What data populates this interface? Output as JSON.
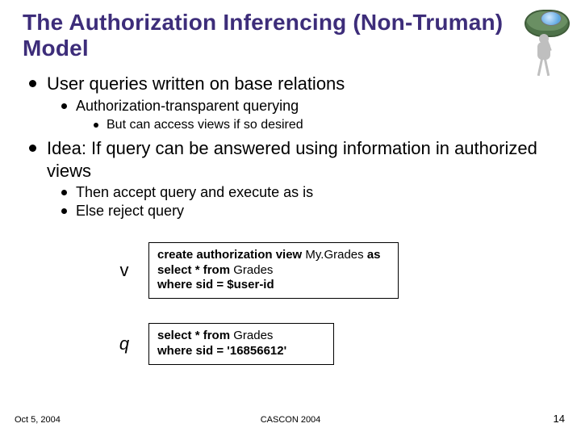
{
  "title": "The Authorization Inferencing (Non-Truman) Model",
  "bullets": {
    "b1": "User queries written on base relations",
    "b1_1": "Authorization-transparent querying",
    "b1_1_1": "But can access views if so desired",
    "b2": "Idea: If query can be answered using information in authorized views",
    "b2_1": "Then accept query and execute as is",
    "b2_2": "Else reject query"
  },
  "code": {
    "v_label": "v",
    "v": {
      "kw_create": "create authorization view",
      "viewname": "My.Grades",
      "kw_as": "as",
      "kw_select": "select * from",
      "relation": "Grades",
      "where": "where sid = $user-id"
    },
    "q_label": "q",
    "q": {
      "kw_select": "select * from",
      "relation": "Grades",
      "where": "where sid = '16856612'"
    }
  },
  "footer": {
    "left": "Oct 5, 2004",
    "center": "CASCON 2004",
    "right": "14"
  }
}
